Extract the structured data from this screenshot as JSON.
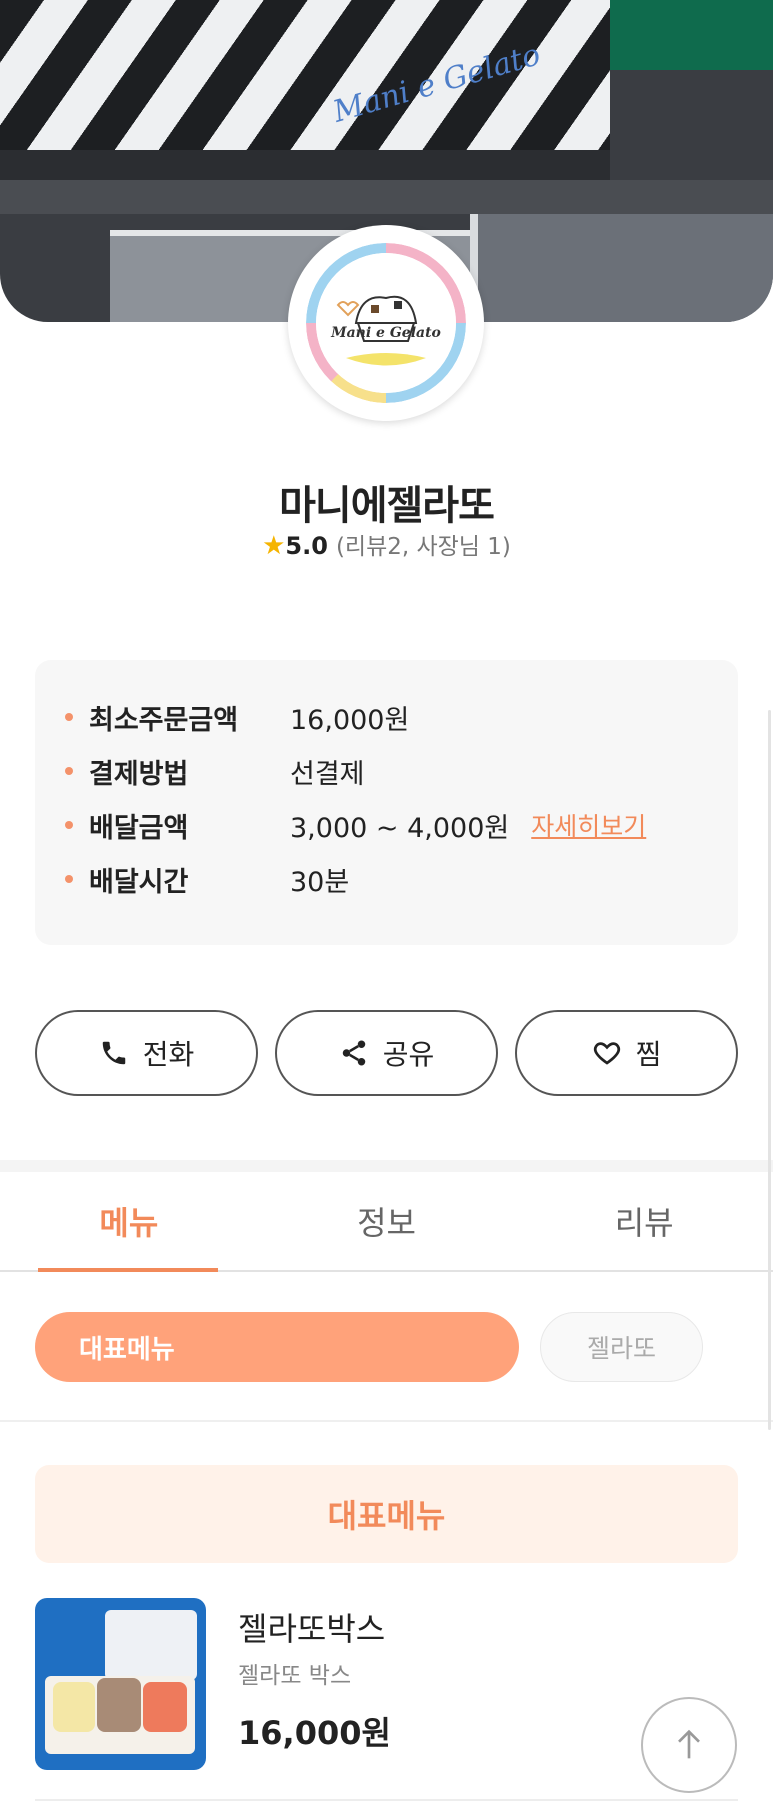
{
  "store": {
    "name": "마니에젤라또",
    "rating": "5.0",
    "review_summary": "(리뷰2, 사장님 1)",
    "logo_text": "Mani e Gelato"
  },
  "info": {
    "rows": [
      {
        "label": "최소주문금액",
        "value": "16,000원"
      },
      {
        "label": "결제방법",
        "value": "선결제"
      },
      {
        "label": "배달금액",
        "value": "3,000 ~ 4,000원",
        "link": "자세히보기"
      },
      {
        "label": "배달시간",
        "value": "30분"
      }
    ]
  },
  "actions": {
    "call": "전화",
    "share": "공유",
    "favorite": "찜"
  },
  "tabs": [
    {
      "label": "메뉴",
      "active": true
    },
    {
      "label": "정보",
      "active": false
    },
    {
      "label": "리뷰",
      "active": false
    }
  ],
  "categories": {
    "selected": "대표메뉴",
    "other": "젤라또"
  },
  "section": {
    "title": "대표메뉴"
  },
  "menu_items": [
    {
      "name": "젤라또박스",
      "description": "젤라또 박스",
      "price": "16,000원"
    }
  ],
  "colors": {
    "accent": "#f28a5a",
    "chip_active": "#ffa27a",
    "section_bg": "#fff2e9",
    "star": "#f5b400"
  },
  "icons": {
    "call": "phone-icon",
    "share": "share-icon",
    "favorite": "heart-icon",
    "rating": "star-icon",
    "scroll_top": "arrow-up-icon"
  }
}
